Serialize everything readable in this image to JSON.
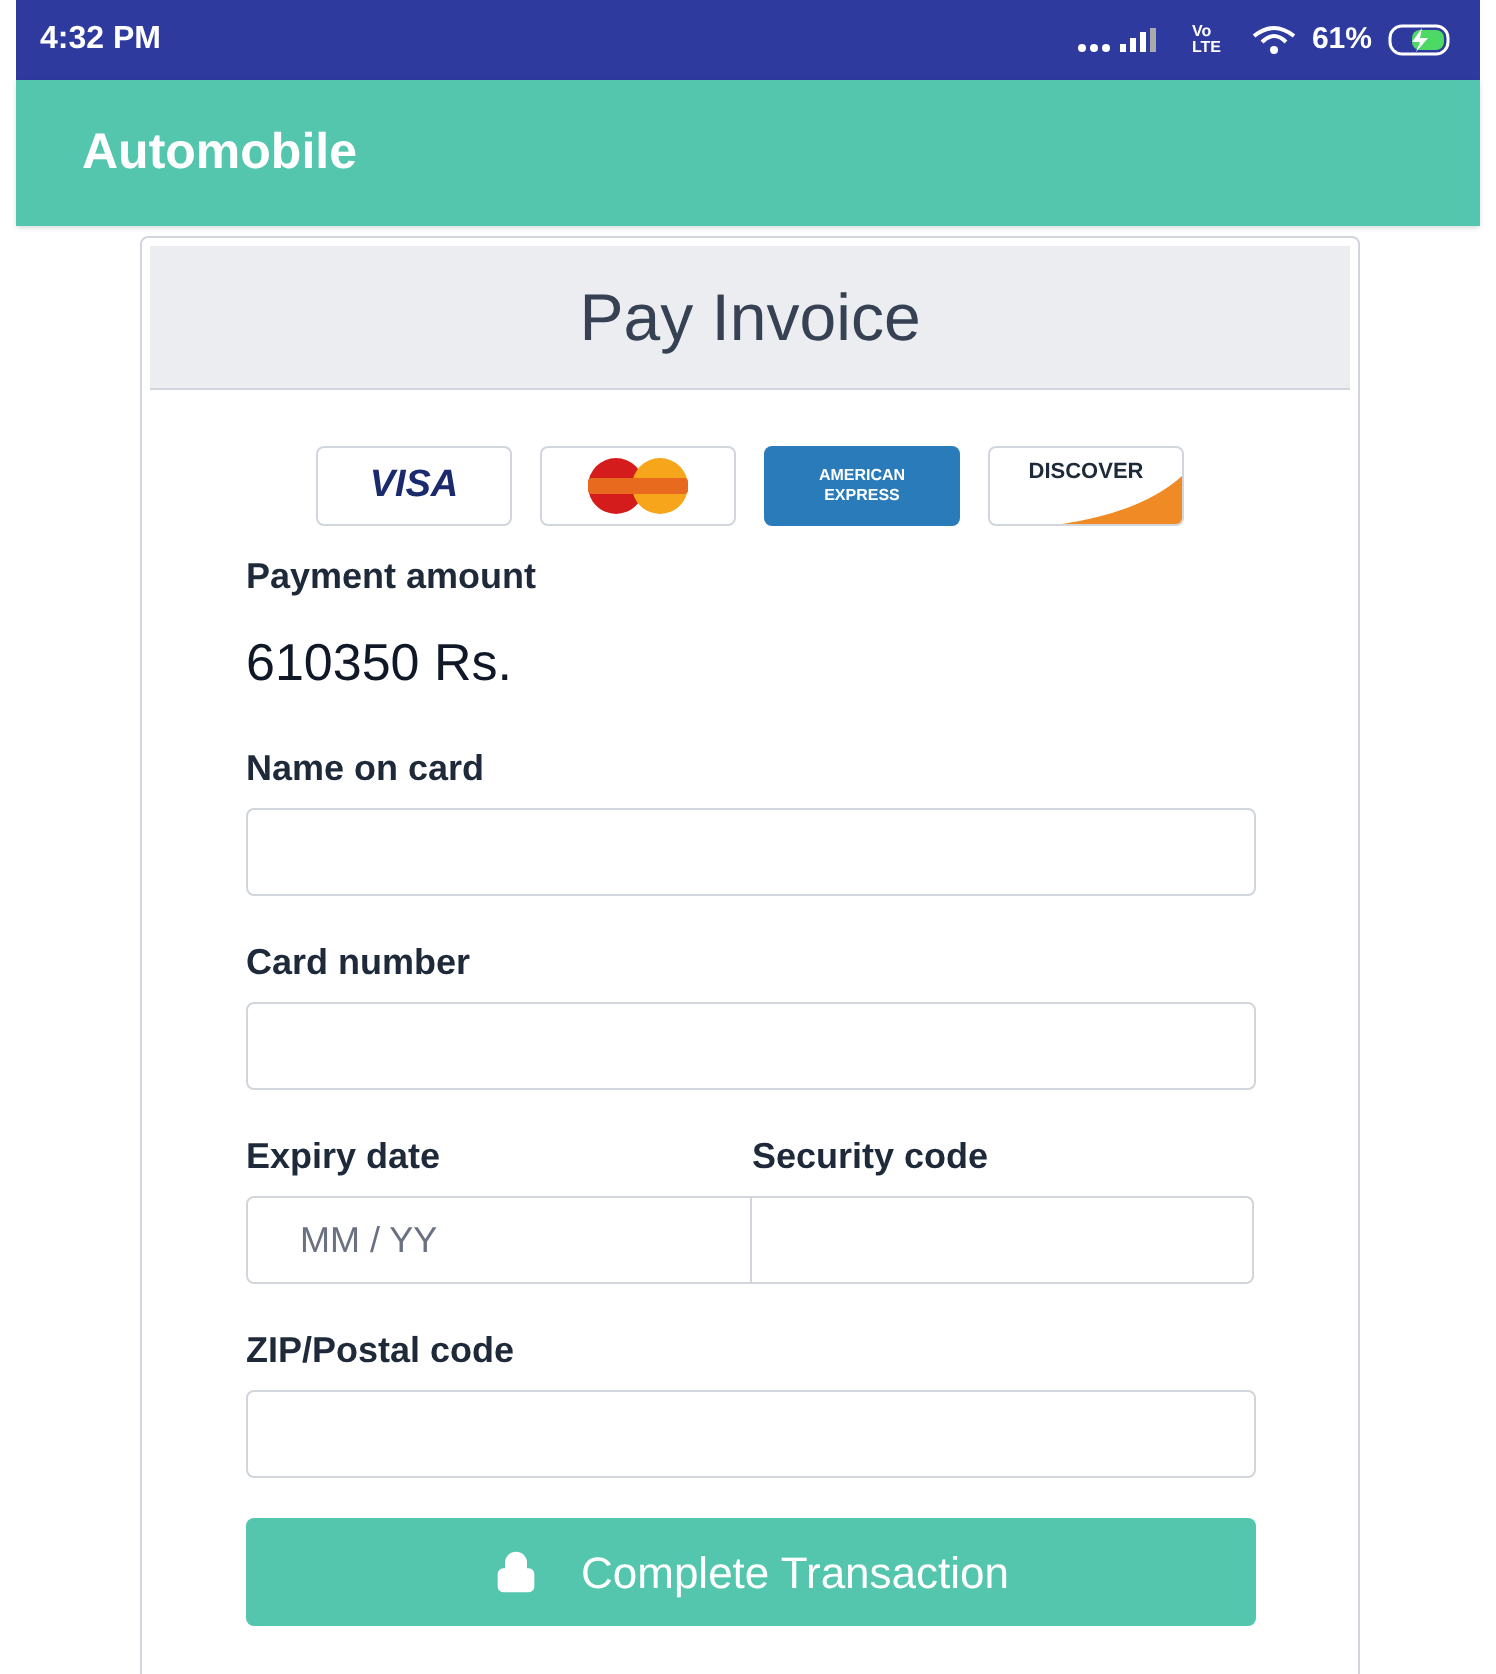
{
  "status_bar": {
    "time": "4:32 PM",
    "network_label": "Vo LTE",
    "battery": "61%"
  },
  "app_bar": {
    "title": "Automobile"
  },
  "invoice": {
    "title": "Pay Invoice",
    "cards": [
      {
        "kind": "visa",
        "label": "VISA"
      },
      {
        "kind": "mastercard"
      },
      {
        "kind": "amex",
        "label": "AMERICAN EXPRESS"
      },
      {
        "kind": "discover",
        "label": "DISCOVER"
      }
    ],
    "amount_label": "Payment amount",
    "amount": "610350 Rs.",
    "fields": [
      {
        "kind": "full",
        "label": "Name on card"
      },
      {
        "kind": "full",
        "label": "Card number"
      },
      {
        "kind": "pair",
        "label": "Expiry date",
        "placeholder": "MM / YY",
        "label_2": "Security code"
      },
      {
        "kind": "full",
        "label": "ZIP/Postal code"
      }
    ],
    "submit": "Complete Transaction"
  }
}
